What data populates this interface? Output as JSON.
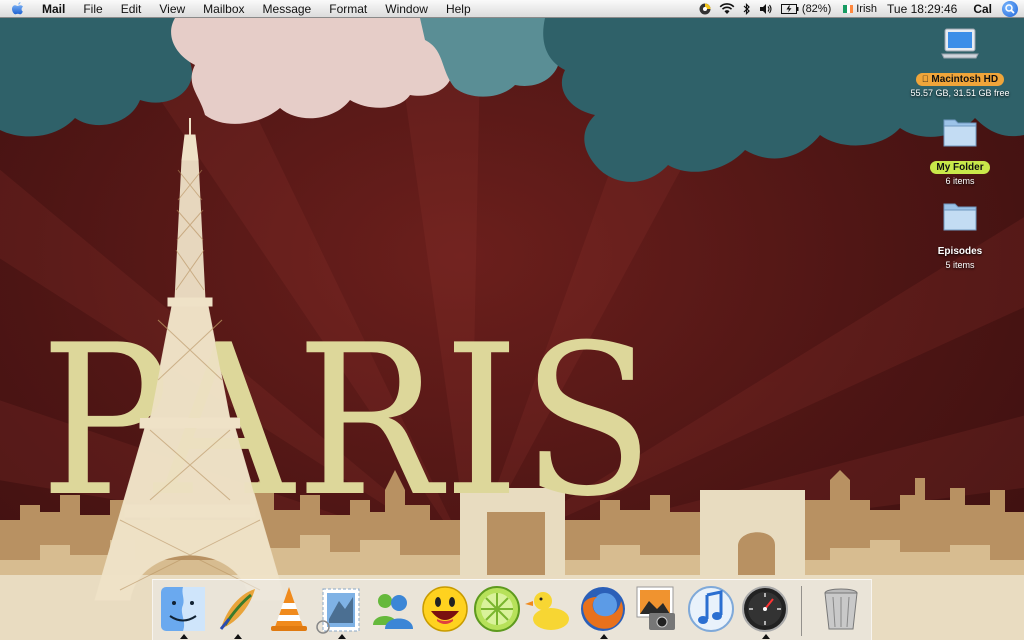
{
  "menubar": {
    "apple_icon": "apple-icon",
    "app_name": "Mail",
    "menus": [
      "File",
      "Edit",
      "View",
      "Mailbox",
      "Message",
      "Format",
      "Window",
      "Help"
    ],
    "battery_percent": "(82%)",
    "input_language": "Irish",
    "clock": "Tue 18:29:46",
    "user": "Cal",
    "status_icons": [
      "itunes-status-icon",
      "wifi-icon",
      "bluetooth-icon",
      "volume-icon",
      "battery-icon",
      "irish-flag-icon",
      "spotlight-icon"
    ]
  },
  "wallpaper": {
    "word": "PARIS",
    "colors": {
      "background": "#4d1514",
      "letters": "#ddd79a",
      "cloud_teal": "#2f6169",
      "cloud_pink": "#e6cdc8",
      "skyline": "#c9a56e"
    }
  },
  "desktop": {
    "icons": [
      {
        "label": "Macintosh HD",
        "sub": "55.57 GB, 31.51 GB free",
        "icon": "hard-drive-icon"
      },
      {
        "label": "My Folder",
        "sub": "6 items",
        "icon": "folder-icon"
      },
      {
        "label": "Episodes",
        "sub": "5 items",
        "icon": "folder-icon"
      }
    ]
  },
  "dock": {
    "items": [
      {
        "icon": "finder-icon",
        "running": true
      },
      {
        "icon": "feather-app-icon",
        "running": true
      },
      {
        "icon": "vlc-cone-icon",
        "running": false
      },
      {
        "icon": "mail-stamp-icon",
        "running": true
      },
      {
        "icon": "messenger-buddies-icon",
        "running": false
      },
      {
        "icon": "yahoo-smiley-icon",
        "running": false
      },
      {
        "icon": "limewire-icon",
        "running": false
      },
      {
        "icon": "cyberduck-icon",
        "running": false
      },
      {
        "icon": "firefox-icon",
        "running": true
      },
      {
        "icon": "iphoto-icon",
        "running": false
      },
      {
        "icon": "itunes-icon",
        "running": false
      },
      {
        "icon": "dashboard-icon",
        "running": true
      },
      {
        "icon": "trash-icon",
        "running": false
      }
    ]
  }
}
